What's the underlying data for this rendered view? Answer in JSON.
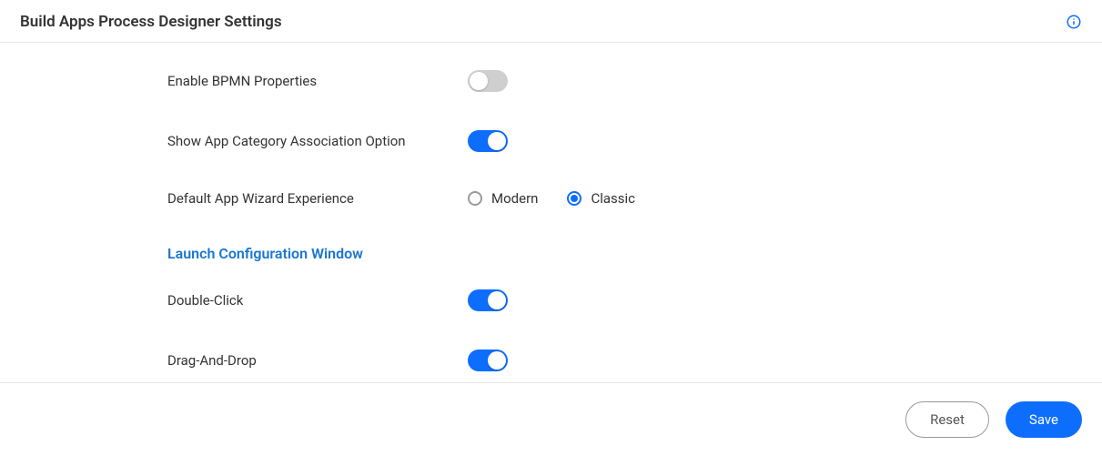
{
  "header": {
    "title": "Build Apps Process Designer Settings",
    "info_icon": "info-icon"
  },
  "settings": {
    "bpmn": {
      "label": "Enable BPMN Properties",
      "value": false
    },
    "app_category": {
      "label": "Show App Category Association Option",
      "value": true
    },
    "wizard_experience": {
      "label": "Default App Wizard Experience",
      "options": [
        {
          "label": "Modern",
          "value": "modern",
          "checked": false
        },
        {
          "label": "Classic",
          "value": "classic",
          "checked": true
        }
      ]
    }
  },
  "section": {
    "launch_config_title": "Launch Configuration Window",
    "double_click": {
      "label": "Double-Click",
      "value": true
    },
    "drag_drop": {
      "label": "Drag-And-Drop",
      "value": true
    }
  },
  "footer": {
    "reset_label": "Reset",
    "save_label": "Save"
  },
  "colors": {
    "accent": "#0d6efd",
    "section_title": "#1976d2",
    "toggle_off": "#cfcfcf"
  }
}
